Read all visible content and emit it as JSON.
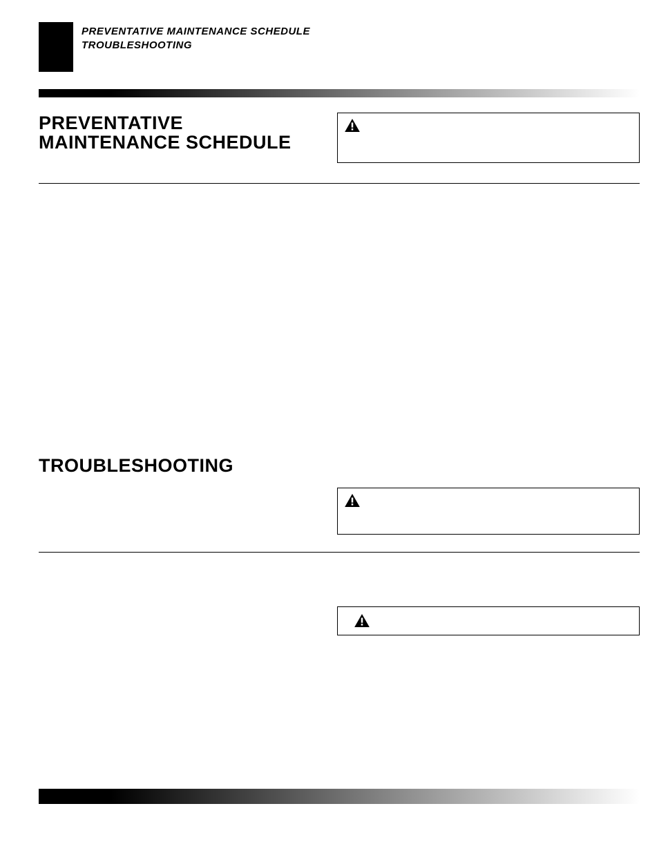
{
  "header": {
    "line1": "PREVENTATIVE MAINTENANCE SCHEDULE",
    "line2": "TROUBLESHOOTING"
  },
  "sections": {
    "title1_line1": "PREVENTATIVE",
    "title1_line2": "MAINTENANCE SCHEDULE",
    "title2": "TROUBLESHOOTING"
  },
  "icons": {
    "warning": "warning-triangle"
  }
}
